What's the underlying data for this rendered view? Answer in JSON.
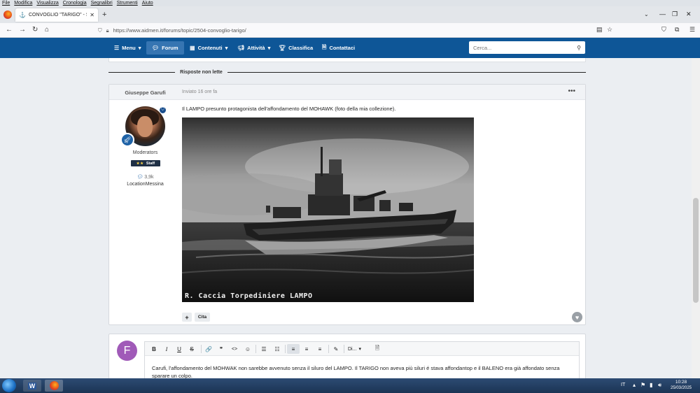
{
  "browser": {
    "menubar": [
      "File",
      "Modifica",
      "Visualizza",
      "Cronologia",
      "Segnalibri",
      "Strumenti",
      "Aiuto"
    ],
    "tab_title": "CONVOGLIO \"TARIGO\" - Storia",
    "url": "https://www.aidmen.it/forums/topic/2504-convoglio-tarigo/",
    "icons": {
      "back": "arrow-left-icon",
      "forward": "arrow-right-icon",
      "reload": "reload-icon",
      "home": "home-icon",
      "shield": "shield-icon",
      "lock": "lock-icon",
      "reader": "reader-view-icon",
      "bookmark": "star-icon",
      "pocket": "pocket-icon",
      "extensions": "puzzle-icon",
      "app_menu": "hamburger-icon"
    }
  },
  "site_nav": {
    "items": [
      {
        "label": "Menu",
        "icon": "list-icon",
        "dropdown": true
      },
      {
        "label": "Forum",
        "icon": "chat-icon",
        "active": true
      },
      {
        "label": "Contenuti",
        "icon": "grid-icon",
        "dropdown": true
      },
      {
        "label": "Attività",
        "icon": "megaphone-icon",
        "dropdown": true
      },
      {
        "label": "Classifica",
        "icon": "trophy-icon"
      },
      {
        "label": "Contattaci",
        "icon": "document-icon"
      }
    ],
    "search_placeholder": "Cerca..."
  },
  "thread": {
    "unread_separator": "Risposte non lette",
    "post": {
      "author": "Giuseppe Garufi",
      "time": "Inviato 16 ore fa",
      "menu": "•••",
      "group": "Moderators",
      "badge": "Staff",
      "badge_pips": "★★",
      "post_count": "3,9k",
      "location": "LocationMessina",
      "text": "Il LAMPO presunto protagonista dell'affondamento del MOHAWK (foto della mia collezione).",
      "image_caption": "R. Caccia Torpediniere LAMPO",
      "actions": {
        "plus": "+",
        "quote": "Cita"
      }
    }
  },
  "reply": {
    "avatar_letter": "F",
    "avatar_color": "#a05ab8",
    "toolbar": {
      "bold": "B",
      "italic": "I",
      "underline": "U",
      "strike": "S",
      "link": "🔗",
      "quote": "❞",
      "code": "<>",
      "emoji": "☺",
      "bullets": "☰",
      "numbered": "☷",
      "align_left": "≡",
      "align_center": "≡",
      "align_right": "≡",
      "paint": "✎",
      "font_dropdown": "Di...",
      "source": "🗎"
    },
    "text": "Carufi, l'affondamento del MOHWAK non sarebbe avvenuto senza il siluro del LAMPO.  Il TARIGO non aveva più siluri é stava affondantop e il BALENO era già affondato senza sparare un colpo."
  },
  "taskbar": {
    "lang": "IT",
    "time": "10:28",
    "date": "25/03/2025"
  },
  "colors": {
    "brand": "#0e5697",
    "nav_active": "#3675b2",
    "page_bg": "#ebeef2"
  }
}
